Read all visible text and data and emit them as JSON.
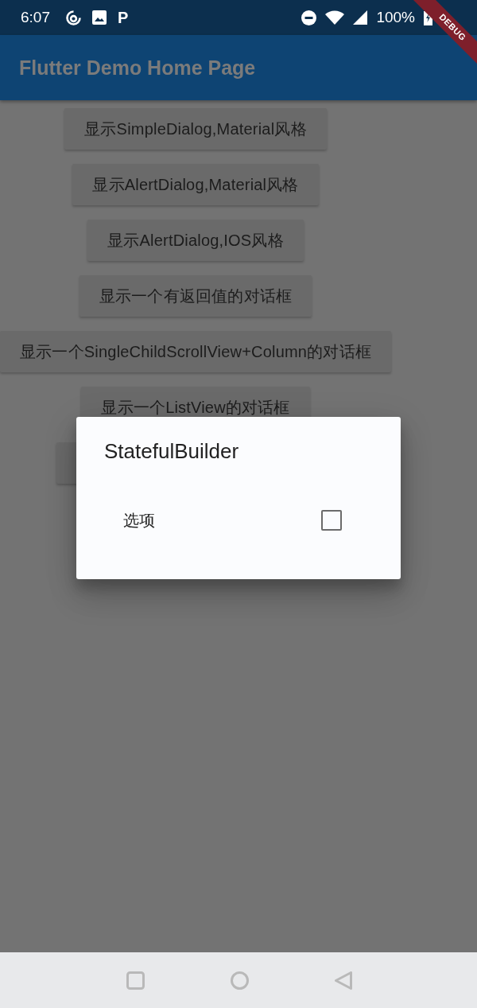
{
  "status_bar": {
    "time": "6:07",
    "notification_glyph": "P",
    "battery": "100%"
  },
  "debug_banner": {
    "label": "DEBUG"
  },
  "app_bar": {
    "title": "Flutter Demo Home Page"
  },
  "buttons": [
    {
      "kind": "text",
      "label": "显示SimpleDialog,Material风格"
    },
    {
      "kind": "text",
      "label": "显示AlertDialog,Material风格"
    },
    {
      "kind": "text",
      "label": "显示AlertDialog,IOS风格"
    },
    {
      "kind": "text",
      "label": "显示一个有返回值的对话框"
    },
    {
      "kind": "text",
      "label": "显示一个SingleChildScrollView+Column的对话框"
    },
    {
      "kind": "text",
      "label": "显示一个ListView的对话框"
    },
    {
      "kind": "covered"
    }
  ],
  "dialog": {
    "title": "StatefulBuilder",
    "option": {
      "label": "选项",
      "checked": false
    }
  }
}
